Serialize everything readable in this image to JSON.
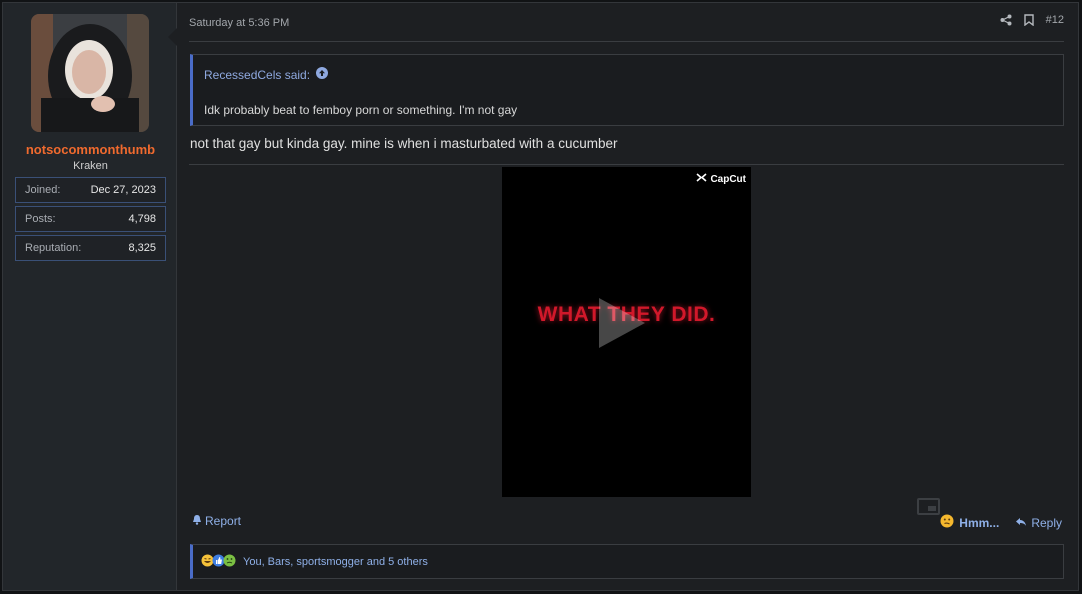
{
  "user": {
    "username": "notsocommonthumb",
    "title": "Kraken",
    "stats": [
      {
        "label": "Joined:",
        "value": "Dec 27, 2023"
      },
      {
        "label": "Posts:",
        "value": "4,798"
      },
      {
        "label": "Reputation:",
        "value": "8,325"
      }
    ]
  },
  "post": {
    "date": "Saturday at 5:36 PM",
    "number": "#12",
    "quote": {
      "author": "RecessedCels said:",
      "text": "Idk probably beat to femboy porn or something. I'm not gay"
    },
    "message": "not that gay but kinda gay. mine is when i masturbated with a cucumber",
    "video": {
      "watermark": "CapCut",
      "overlay_text": "WHAT THEY DID."
    }
  },
  "actions": {
    "report": "Report",
    "reaction": "Hmm...",
    "reply": "Reply"
  },
  "reactions": {
    "summary": "You, Bars, sportsmogger and 5 others"
  },
  "colors": {
    "username": "#f06a2e",
    "link": "#8fb0e8",
    "quote_accent": "#4a6cc8",
    "video_text": "#d1182a"
  }
}
